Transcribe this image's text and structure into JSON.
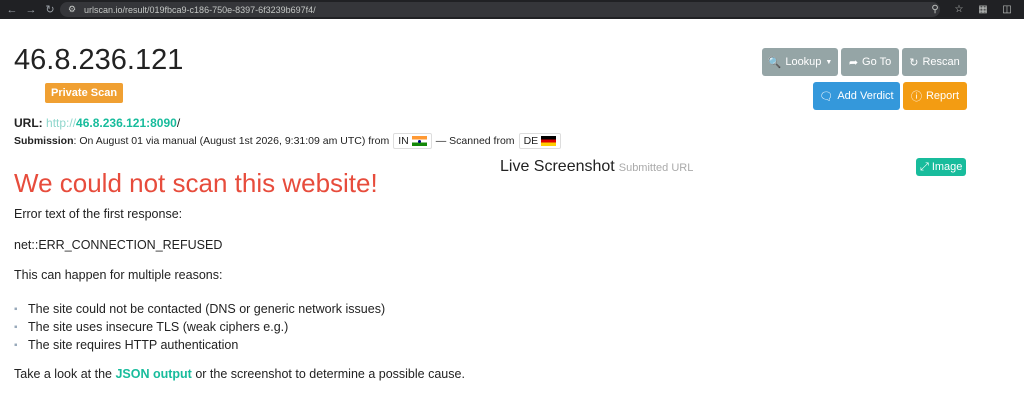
{
  "browser": {
    "url": "urlscan.io/result/019fbca9-c186-750e-8397-6f3239b697f4/"
  },
  "header": {
    "title": "46.8.236.121",
    "private_badge": "Private Scan"
  },
  "actions": {
    "lookup": "Lookup",
    "goto": "Go To",
    "rescan": "Rescan",
    "add_verdict": "Add Verdict",
    "report": "Report"
  },
  "scan": {
    "url_label": "URL:",
    "url_scheme": "http://",
    "url_host": "46.8.236.121:8090",
    "url_path": "/",
    "submission_label": "Submission",
    "submission_text": ": On August 01 via manual (August 1st 2026, 9:31:09 am UTC) from",
    "from_country": "IN",
    "scanned_from_text": "— Scanned from",
    "scanned_country": "DE"
  },
  "screenshot": {
    "title": "Live Screenshot",
    "subtitle": "Submitted URL",
    "image_button": "Image"
  },
  "error": {
    "title": "We could not scan this website!",
    "intro": "Error text of the first response:",
    "code": "net::ERR_CONNECTION_REFUSED",
    "reasons_intro": "This can happen for multiple reasons:",
    "reasons": [
      "The site could not be contacted (DNS or generic network issues)",
      "The site uses insecure TLS (weak ciphers e.g.)",
      "The site requires HTTP authentication"
    ],
    "footer_pre": "Take a look at the ",
    "footer_link": "JSON output",
    "footer_post": " or the screenshot to determine a possible cause."
  },
  "colors": {
    "error": "#e74c3c",
    "accent": "#18bc9c",
    "private": "#f0a032",
    "chrome": "#202124"
  }
}
